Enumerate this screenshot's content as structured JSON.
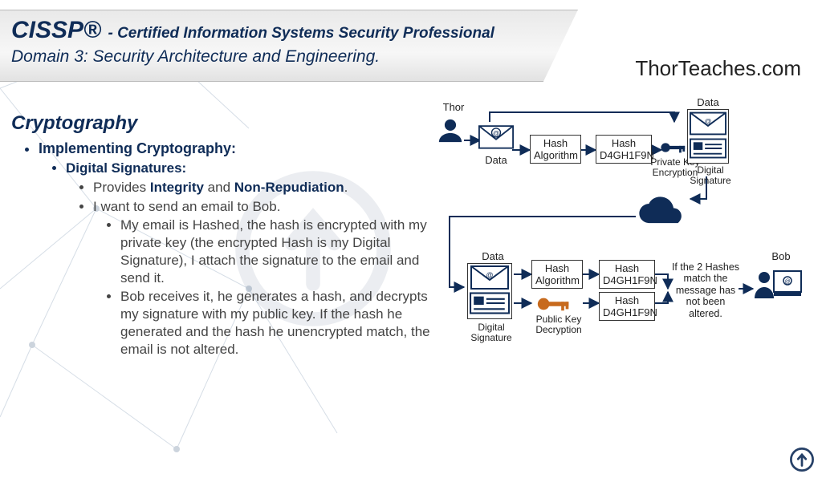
{
  "header": {
    "title_main": "CISSP®",
    "title_sub": "- Certified Information Systems Security Professional",
    "domain_line": "Domain 3: Security Architecture and Engineering.",
    "brand": "ThorTeaches.com"
  },
  "content": {
    "heading": "Cryptography",
    "l1": "Implementing Cryptography:",
    "l2": "Digital Signatures:",
    "l3a_pre": "Provides ",
    "l3a_b1": "Integrity",
    "l3a_mid": " and ",
    "l3a_b2": "Non-Repudiation",
    "l3a_post": ".",
    "l3b": "I want to send an email to Bob.",
    "l4a": "My email is Hashed, the hash is encrypted with my private key (the encrypted Hash is my Digital Signature), I attach the signature to the email and send it.",
    "l4b": "Bob receives it, he generates a hash, and decrypts my signature with my public key. If the hash he generated and the hash he unencrypted match, the email is not altered."
  },
  "diagram": {
    "sender": "Thor",
    "receiver": "Bob",
    "data_label": "Data",
    "hash_alg": "Hash Algorithm",
    "hash_value": "Hash D4GH1F9N",
    "hash_value2": "Hash D4GH1F9N",
    "priv_key": "Private Key Encryption",
    "digital_sig": "Digital Signature",
    "pub_key": "Public Key Decryption",
    "match_text": "If the 2 Hashes match the message has not been altered."
  }
}
